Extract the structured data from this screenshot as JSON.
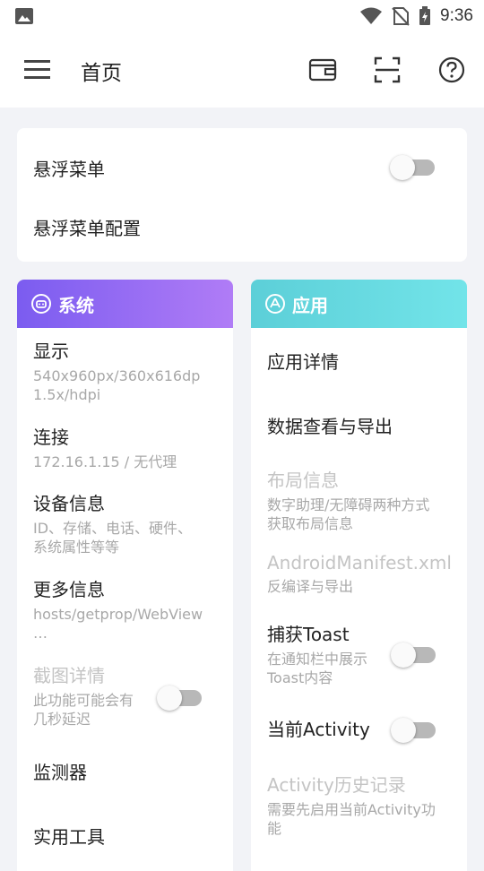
{
  "status_bar": {
    "time": "9:36"
  },
  "toolbar": {
    "title": "首页"
  },
  "floating_card": {
    "floating_menu": "悬浮菜单",
    "floating_menu_config": "悬浮菜单配置"
  },
  "system": {
    "header": "系统",
    "display_title": "显示",
    "display_sub": "540x960px/360x616dp\n1.5x/hdpi",
    "connection_title": "连接",
    "connection_sub": "172.16.1.15 / 无代理",
    "device_title": "设备信息",
    "device_sub": "ID、存储、电话、硬件、\n系统属性等等",
    "more_title": "更多信息",
    "more_sub": "hosts/getprop/WebView\n…",
    "screenshot_title": "截图详情",
    "screenshot_sub": "此功能可能会有\n几秒延迟",
    "monitor_title": "监测器",
    "tools_title": "实用工具"
  },
  "apps": {
    "header": "应用",
    "app_detail": "应用详情",
    "data_view": "数据查看与导出",
    "layout_title": "布局信息",
    "layout_sub": "数字助理/无障碍两种方式\n获取布局信息",
    "manifest_title": "AndroidManifest.xml",
    "manifest_sub": "反编译与导出",
    "toast_title": "捕获Toast",
    "toast_sub": "在通知栏中展示\nToast内容",
    "activity_title": "当前Activity",
    "history_title": "Activity历史记录",
    "history_sub": "需要先启用当前Activity功\n能"
  },
  "colors": {
    "system_gradient": [
      "#7b5cf0",
      "#b07cf6"
    ],
    "apps_gradient": [
      "#5ccfd8",
      "#72e4e9"
    ]
  },
  "toggles": {
    "floating_menu": false,
    "screenshot": false,
    "toast": false,
    "activity": false
  }
}
